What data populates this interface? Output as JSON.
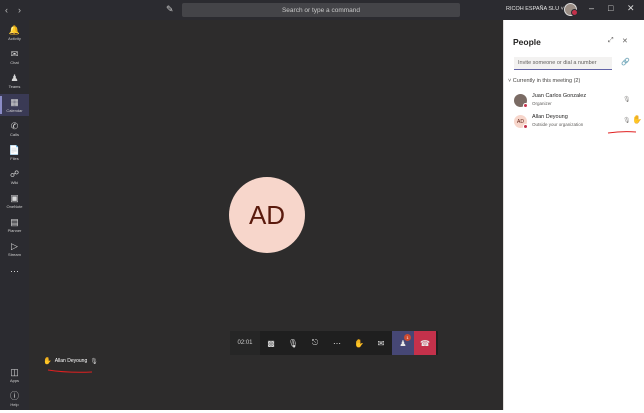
{
  "titlebar": {
    "back_icon": "chevron-left-icon",
    "forward_icon": "chevron-right-icon",
    "compose_icon": "compose-icon",
    "search_placeholder": "Search or type a command",
    "org_name": "RICOH ESPAÑA SLU",
    "org_chevron": "chevron-down-icon"
  },
  "rail": {
    "items": [
      {
        "label": "Activity",
        "icon": "bell-icon"
      },
      {
        "label": "Chat",
        "icon": "chat-icon"
      },
      {
        "label": "Teams",
        "icon": "teams-icon"
      },
      {
        "label": "Calendar",
        "icon": "calendar-icon"
      },
      {
        "label": "Calls",
        "icon": "phone-icon"
      },
      {
        "label": "Files",
        "icon": "file-icon"
      },
      {
        "label": "Wiki",
        "icon": "wiki-icon"
      },
      {
        "label": "OneNote",
        "icon": "onenote-icon"
      },
      {
        "label": "Planner",
        "icon": "planner-icon"
      },
      {
        "label": "Stream",
        "icon": "stream-icon"
      },
      {
        "label": "Apps",
        "icon": "apps-icon"
      },
      {
        "label": "Help",
        "icon": "help-icon"
      }
    ]
  },
  "stage": {
    "participant_initials": "AD",
    "participant_tag_name": "Allan Deyoung"
  },
  "call_controls": {
    "timer": "02:01",
    "people_badge": "1"
  },
  "people_panel": {
    "title": "People",
    "invite_placeholder": "Invite someone or dial a number",
    "section_label": "Currently in this meeting (2)",
    "participants": [
      {
        "name": "Juan Carlos Gonzalez",
        "role": "Organizer"
      },
      {
        "name": "Allan Deyoung",
        "role": "Outside your organization",
        "initials": "AD"
      }
    ]
  },
  "colors": {
    "accent": "#6264a7",
    "hangup": "#c4314b",
    "hand": "#f0b400",
    "annotation": "#e02020"
  }
}
